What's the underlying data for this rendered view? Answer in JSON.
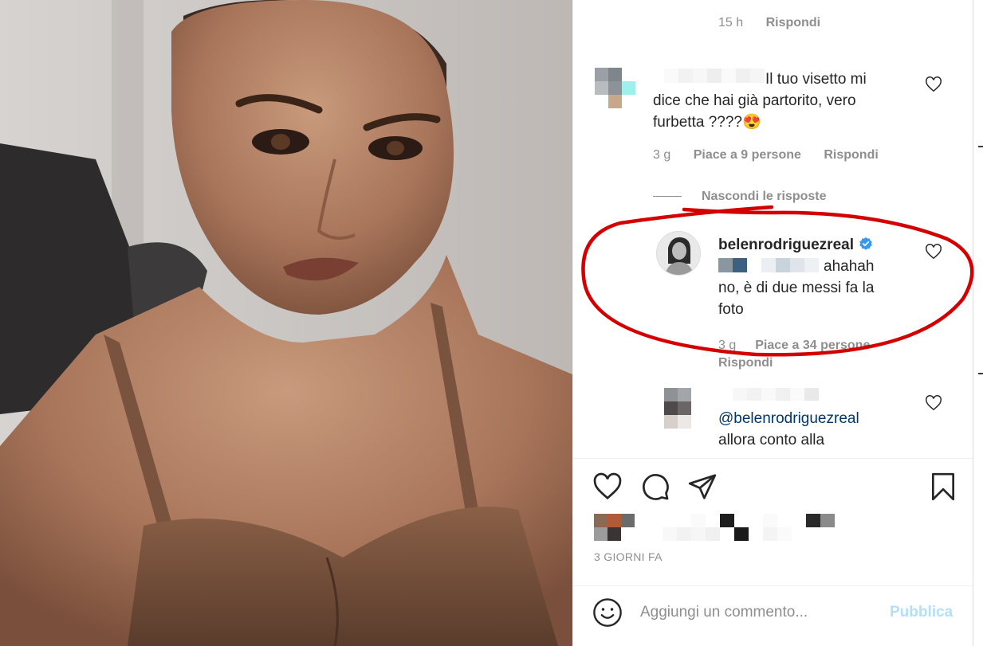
{
  "post": {
    "username": "belenrodriguezreal",
    "time_ago": "3 GIORNI FA"
  },
  "comments": {
    "prev_meta": {
      "time": "15 h",
      "reply": "Rispondi"
    },
    "comment1": {
      "text_line1": "Il tuo visetto mi",
      "text_line2": "dice che hai già partorito, vero",
      "text_line3": "furbetta ????😍",
      "time": "3 g",
      "likes": "Piace a 9 persone",
      "reply": "Rispondi"
    },
    "hide_replies": "Nascondi le risposte",
    "reply1": {
      "username": "belenrodriguezreal",
      "text_line1": "ahahah",
      "text_line2": "no, è di due messi fa la",
      "text_line3": "foto",
      "time": "3 g",
      "likes": "Piace a 34 persone",
      "reply": "Rispondi"
    },
    "reply2": {
      "mention": "@belenrodriguezreal",
      "text_line2": "allora conto alla"
    }
  },
  "add_comment": {
    "placeholder": "Aggiungi un commento...",
    "publish_label": "Pubblica"
  },
  "icons": {
    "like": "heart-icon",
    "comment": "comment-icon",
    "share": "paper-plane-icon",
    "save": "bookmark-icon",
    "emoji": "emoji-icon",
    "verified": "verified-badge-icon"
  },
  "colors": {
    "accent_publish_disabled": "#b2dffc",
    "verified": "#3897f0",
    "annotation": "#d40000",
    "mention": "#00376b"
  }
}
